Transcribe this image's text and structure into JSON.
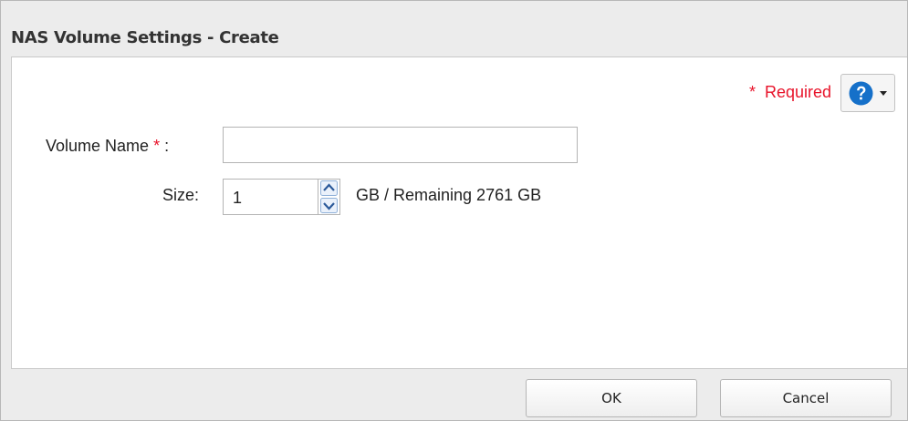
{
  "dialog": {
    "title": "NAS Volume Settings - Create"
  },
  "required": {
    "star": "*",
    "label": "Required"
  },
  "form": {
    "volume_name": {
      "label": "Volume Name",
      "star": "*",
      "colon": " :",
      "value": ""
    },
    "size": {
      "label": "Size:",
      "value": "1",
      "remaining_text": "GB / Remaining 2761 GB"
    }
  },
  "buttons": {
    "ok": "OK",
    "cancel": "Cancel"
  },
  "icons": {
    "help": "help-icon",
    "spin_up": "arrow-up-icon",
    "spin_down": "arrow-down-icon",
    "dropdown": "chevron-down-icon"
  },
  "colors": {
    "required": "#e8132a",
    "help_blue": "#1570c9"
  }
}
